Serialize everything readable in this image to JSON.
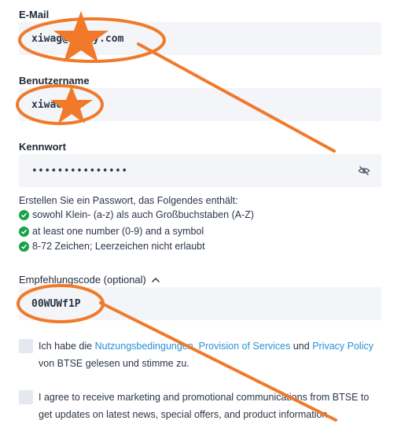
{
  "email": {
    "label": "E-Mail",
    "value": "xiwag@arugy.com"
  },
  "username": {
    "label": "Benutzername",
    "value": "xiwa6"
  },
  "password": {
    "label": "Kennwort",
    "value": "•••••••••••••••",
    "icon": "eye-off-icon"
  },
  "password_hint": {
    "intro": "Erstellen Sie ein Passwort, das Folgendes enthält:",
    "requirements": [
      "sowohl Klein- (a-z) als auch Großbuchstaben (A-Z)",
      "at least one number (0-9) and a symbol",
      "8-72 Zeichen; Leerzeichen nicht erlaubt"
    ],
    "check_color": "#16a34a"
  },
  "referral": {
    "label": "Empfehlungscode (optional)",
    "value": "00WUWf1P"
  },
  "terms": {
    "prefix": "Ich habe die ",
    "link1": "Nutzungsbedingungen",
    "sep1": ", ",
    "link2": "Provision of Services",
    "sep2": " und ",
    "link3": "Privacy Policy",
    "suffix": "von BTSE gelesen und stimme zu."
  },
  "marketing": {
    "line1": "I agree to receive marketing and promotional communications from BTSE to",
    "line2": "get updates on latest news, special offers, and product information."
  },
  "annotation_color": "#f07a2a",
  "link_color": "#2a8fd6"
}
